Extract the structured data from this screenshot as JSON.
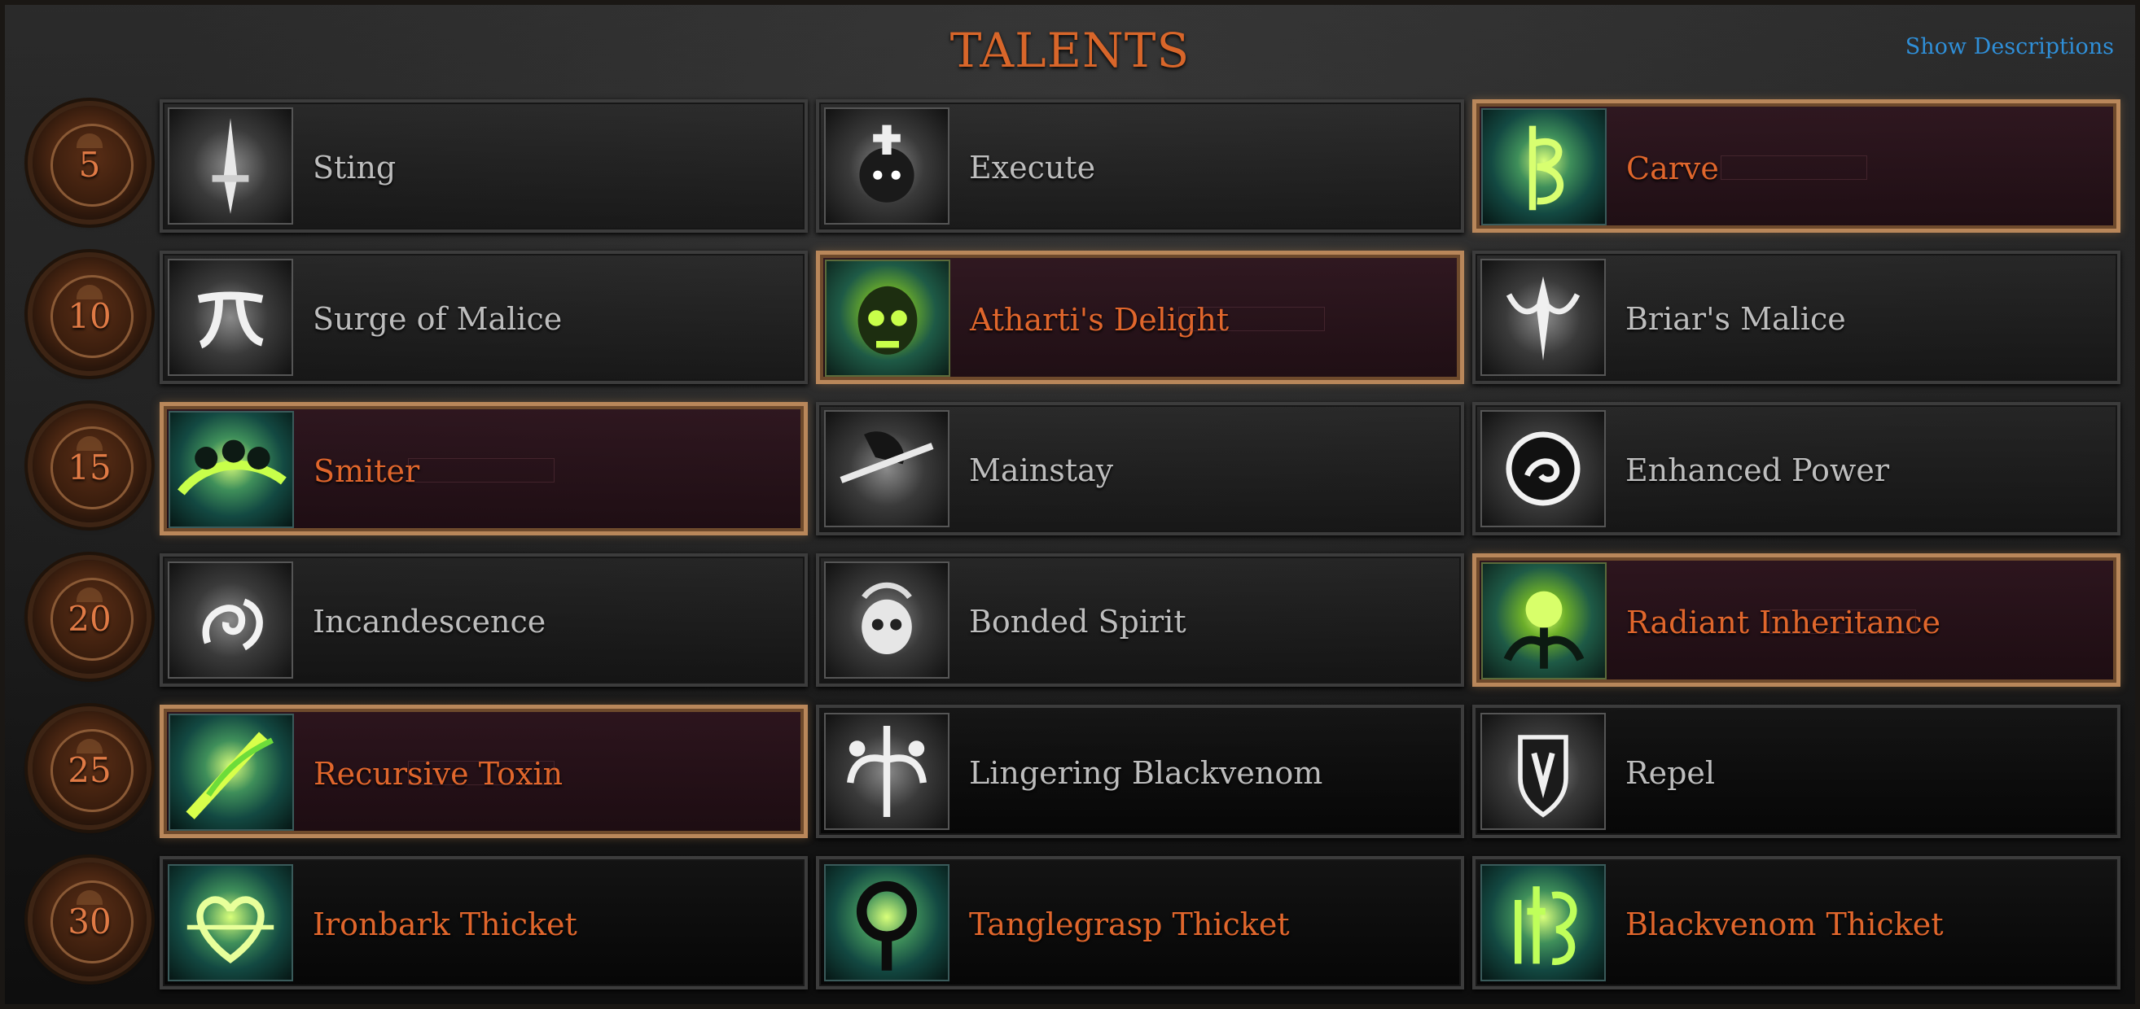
{
  "header": {
    "title": "TALENTS",
    "show_descriptions": "Show Descriptions"
  },
  "colors": {
    "accent_orange": "#e0662c",
    "link_blue": "#2f8fd8",
    "selected_border": "#b9875a"
  },
  "rows": [
    {
      "level": "5",
      "talents": [
        {
          "name": "Sting",
          "selected": false,
          "icon": "sting-icon"
        },
        {
          "name": "Execute",
          "selected": false,
          "icon": "execute-icon"
        },
        {
          "name": "Carve",
          "selected": true,
          "icon": "carve-icon"
        }
      ]
    },
    {
      "level": "10",
      "talents": [
        {
          "name": "Surge of Malice",
          "selected": false,
          "icon": "surge-of-malice-icon"
        },
        {
          "name": "Atharti's Delight",
          "selected": true,
          "icon": "athartis-delight-icon"
        },
        {
          "name": "Briar's Malice",
          "selected": false,
          "icon": "briars-malice-icon"
        }
      ]
    },
    {
      "level": "15",
      "talents": [
        {
          "name": "Smiter",
          "selected": true,
          "icon": "smiter-icon"
        },
        {
          "name": "Mainstay",
          "selected": false,
          "icon": "mainstay-icon"
        },
        {
          "name": "Enhanced Power",
          "selected": false,
          "icon": "enhanced-power-icon"
        }
      ]
    },
    {
      "level": "20",
      "talents": [
        {
          "name": "Incandescence",
          "selected": false,
          "icon": "incandescence-icon"
        },
        {
          "name": "Bonded Spirit",
          "selected": false,
          "icon": "bonded-spirit-icon"
        },
        {
          "name": "Radiant Inheritance",
          "selected": true,
          "icon": "radiant-inheritance-icon"
        }
      ]
    },
    {
      "level": "25",
      "talents": [
        {
          "name": "Recursive Toxin",
          "selected": true,
          "icon": "recursive-toxin-icon"
        },
        {
          "name": "Lingering Blackvenom",
          "selected": false,
          "icon": "lingering-blackvenom-icon"
        },
        {
          "name": "Repel",
          "selected": false,
          "icon": "repel-icon"
        }
      ]
    },
    {
      "level": "30",
      "talents": [
        {
          "name": "Ironbark Thicket",
          "selected": false,
          "icon": "ironbark-thicket-icon"
        },
        {
          "name": "Tanglegrasp Thicket",
          "selected": false,
          "icon": "tanglegrasp-thicket-icon"
        },
        {
          "name": "Blackvenom Thicket",
          "selected": false,
          "icon": "blackvenom-thicket-icon"
        }
      ]
    }
  ]
}
